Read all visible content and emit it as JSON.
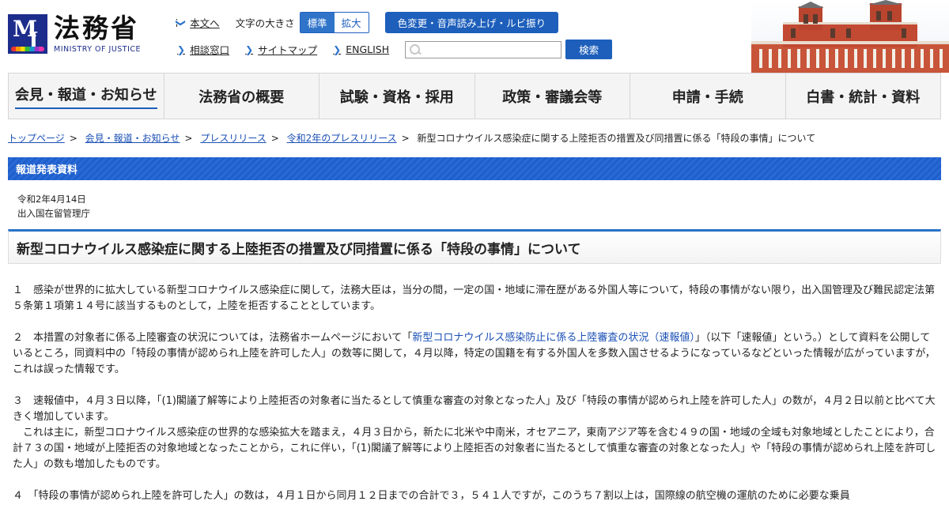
{
  "logo": {
    "mark_m": "M",
    "mark_j": "J",
    "jp": "法務省",
    "en": "MINISTRY OF JUSTICE"
  },
  "header": {
    "skip_link": "本文へ",
    "text_size_label": "文字の大きさ",
    "size_standard": "標準",
    "size_large": "拡大",
    "color_button": "色変更・音声読み上げ・ルビ振り",
    "consult_link": "相談窓口",
    "sitemap_link": "サイトマップ",
    "english_link": "ENGLISH",
    "search_value": "",
    "search_button": "検索"
  },
  "nav": {
    "items": [
      {
        "label": "会見・報道・お知らせ",
        "active": true
      },
      {
        "label": "法務省の概要"
      },
      {
        "label": "試験・資格・採用"
      },
      {
        "label": "政策・審議会等"
      },
      {
        "label": "申請・手続"
      },
      {
        "label": "白書・統計・資料"
      }
    ]
  },
  "breadcrumb": {
    "items": [
      "トップページ",
      "会見・報道・お知らせ",
      "プレスリリース",
      "令和2年のプレスリリース"
    ],
    "current": "新型コロナウイルス感染症に関する上陸拒否の措置及び同措置に係る「特段の事情」について"
  },
  "press": {
    "label": "報道発表資料",
    "date": "令和2年4月14日",
    "agency": "出入国在留管理庁",
    "title": "新型コロナウイルス感染症に関する上陸拒否の措置及び同措置に係る「特段の事情」について"
  },
  "body": {
    "p1": "１　感染が世界的に拡大している新型コロナウイルス感染症に関して，法務大臣は，当分の間，一定の国・地域に滞在歴がある外国人等について，特段の事情がない限り，出入国管理及び難民認定法第５条第１項第１４号に該当するものとして，上陸を拒否することとしています。",
    "p2_before": "２　本措置の対象者に係る上陸審査の状況については，法務省ホームページにおいて「",
    "p2_link": "新型コロナウイルス感染防止に係る上陸審査の状況（速報値）",
    "p2_after": "」（以下「速報値」という。）として資料を公開しているところ，同資料中の「特段の事情が認められ上陸を許可した人」の数等に関して，４月以降，特定の国籍を有する外国人を多数入国させるようになっているなどといった情報が広がっていますが，これは誤った情報です。",
    "p3": "３　速報値中，４月３日以降，「(1)閣議了解等により上陸拒否の対象者に当たるとして慎重な審査の対象となった人」及び「特段の事情が認められ上陸を許可した人」の数が，４月２日以前と比べて大きく増加しています。",
    "p3b": "これは主に，新型コロナウイルス感染症の世界的な感染拡大を踏まえ，４月３日から，新たに北米や中南米，オセアニア，東南アジア等を含む４９の国・地域の全域も対象地域としたことにより，合計７３の国・地域が上陸拒否の対象地域となったことから，これに伴い，「(1)閣議了解等により上陸拒否の対象者に当たるとして慎重な審査の対象となった人」や「特段の事情が認められ上陸を許可した人」の数も増加したものです。",
    "p4": "４　「特段の事情が認められ上陸を許可した人」の数は，４月１日から同月１２日までの合計で３，５４１人ですが，このうち７割以上は，国際線の航空機の運航のために必要な乗員"
  }
}
